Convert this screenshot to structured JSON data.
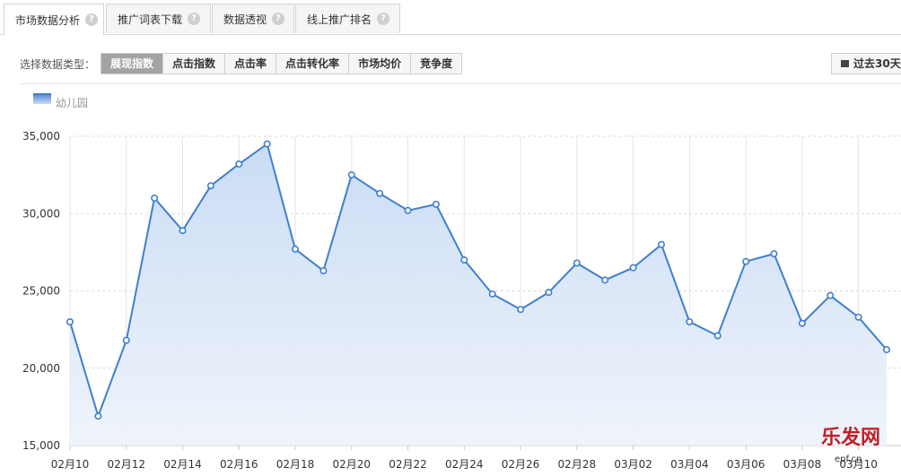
{
  "tabs": [
    {
      "label": "市场数据分析",
      "active": true
    },
    {
      "label": "推广词表下载",
      "active": false
    },
    {
      "label": "数据透视",
      "active": false
    },
    {
      "label": "线上推广排名",
      "active": false
    }
  ],
  "filter": {
    "label": "选择数据类型：",
    "options": [
      "展现指数",
      "点击指数",
      "点击率",
      "点击转化率",
      "市场均价",
      "竞争度"
    ],
    "selected": "展现指数",
    "range_label": "过去30天"
  },
  "legend": {
    "label": "幼儿园"
  },
  "watermark": {
    "text": "乐发网",
    "url": "epf.cn"
  },
  "chart_data": {
    "type": "area",
    "title": "",
    "xlabel": "",
    "ylabel": "",
    "ylim": [
      15000,
      35000
    ],
    "ytick_labels": [
      "15,000",
      "20,000",
      "25,000",
      "30,000",
      "35,000"
    ],
    "xtick_labels": [
      "02月10",
      "02月12",
      "02月14",
      "02月16",
      "02月18",
      "02月20",
      "02月22",
      "02月24",
      "02月26",
      "02月28",
      "03月02",
      "03月04",
      "03月06",
      "03月08",
      "03月10"
    ],
    "x": [
      "02月10",
      "02月11",
      "02月12",
      "02月13",
      "02月14",
      "02月15",
      "02月16",
      "02月17",
      "02月18",
      "02月19",
      "02月20",
      "02月21",
      "02月22",
      "02月23",
      "02月24",
      "02月25",
      "02月26",
      "02月27",
      "02月28",
      "03月01",
      "03月02",
      "03月03",
      "03月04",
      "03月05",
      "03月06",
      "03月07",
      "03月08",
      "03月09",
      "03月10",
      "03月11"
    ],
    "series": [
      {
        "name": "幼儿园",
        "color": "#3f7fcf",
        "values": [
          23000,
          16900,
          21800,
          31000,
          28900,
          31800,
          33200,
          34500,
          27700,
          26300,
          32500,
          31300,
          30200,
          30600,
          27000,
          24800,
          23800,
          24900,
          26800,
          25700,
          26500,
          28000,
          23000,
          22100,
          26900,
          27400,
          22900,
          24700,
          23300,
          21200
        ]
      }
    ],
    "grid": true,
    "legend_position": "top-left"
  }
}
